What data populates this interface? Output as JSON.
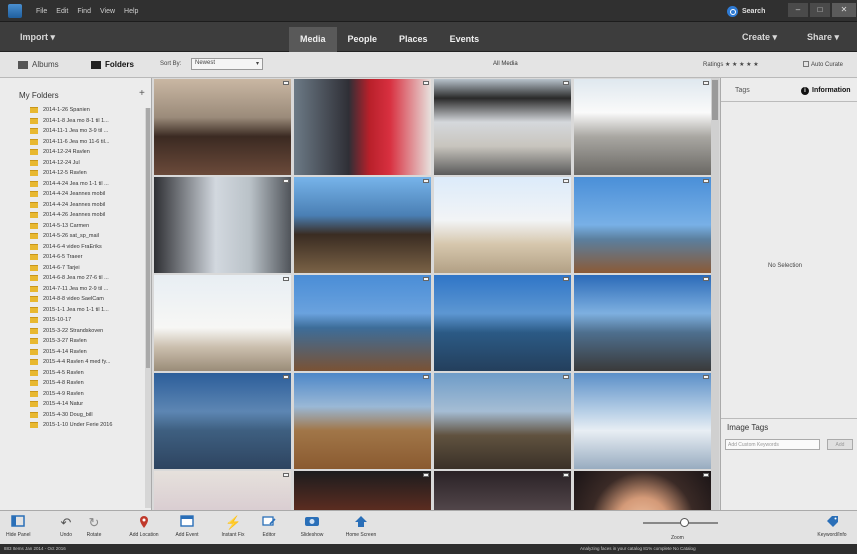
{
  "titlebar": {
    "menus": [
      "File",
      "Edit",
      "Find",
      "View",
      "Help"
    ],
    "search_label": "Search",
    "window_controls": [
      "–",
      "□",
      "✕"
    ]
  },
  "topbar": {
    "import_label": "Import ▾",
    "tabs": [
      {
        "label": "Media",
        "active": true
      },
      {
        "label": "People",
        "active": false
      },
      {
        "label": "Places",
        "active": false
      },
      {
        "label": "Events",
        "active": false
      }
    ],
    "create_label": "Create ▾",
    "share_label": "Share ▾"
  },
  "subbar": {
    "albums_label": "Albums",
    "folders_label": "Folders",
    "sort_by_label": "Sort By:",
    "sort_value": "Newest",
    "view_title": "All Media",
    "ratings_label": "Ratings ★ ★ ★ ★ ★",
    "auto_curate_label": "Auto Curate"
  },
  "left_panel": {
    "header": "My Folders",
    "folders": [
      "2014-1-26 Spanien",
      "2014-1-8 Jea mo 8-1 til 1...",
      "2014-11-1 Jea mo 3-9 til ...",
      "2014-11-6 Jea mo 11-6 til...",
      "2014-12-24 Ravlen",
      "2014-12-24 Jul",
      "2014-12-5 Ravlen",
      "2014-4-24 Jea mo 1-1 til ...",
      "2014-4-24 Jeannes mobil",
      "2014-4-24 Jeannes mobil",
      "2014-4-26 Jeannes mobil",
      "2014-5-13 Carmen",
      "2014-5-26 sat_sp_mail",
      "2014-6-4 video FraEriks",
      "2014-6-5 Traeer",
      "2014-6-7 Tarjei",
      "2014-6-8 Jea mo 27-6 til ...",
      "2014-7-11 Jea mo 2-9 til ...",
      "2014-8-8 video SaelCam",
      "2015-1-1 Jea mo 1-1 til 1...",
      "2015-10-17",
      "2015-3-22 Strandskoven",
      "2015-3-27 Ravlen",
      "2015-4-14 Ravlen",
      "2015-4-4 Ravlen 4 med fy...",
      "2015-4-5 Ravlen",
      "2015-4-8 Ravlen",
      "2015-4-9 Ravlen",
      "2015-4-14 Natur",
      "2015-4-30 Doug_bill",
      "2015-1-10 Under Ferie 2016"
    ]
  },
  "grid": {
    "thumbs": [
      "girl-portrait-platform",
      "people-red-sign-station",
      "station-platform-canopy",
      "platform-walkway-sun",
      "person-walking-platform",
      "girl-smiling-platform",
      "winter-shore-trees",
      "tree-shoreline-sea",
      "tree-silhouette-beach",
      "bare-tree-sea-view",
      "calm-sea-horizon",
      "coast-path-sunset",
      "sea-horizon-blue",
      "dry-grass-sea",
      "marsh-water-dusk",
      "frozen-shore-ice",
      "childs-drawing",
      "christmas-tree-party",
      "indoor-dim-scene",
      "woman-face-closeup"
    ]
  },
  "right_panel": {
    "tags_tab": "Tags",
    "info_tab": "Information",
    "no_selection": "No Selection",
    "image_tags_label": "Image Tags",
    "tag_placeholder": "Add Custom Keywords",
    "add_label": "Add"
  },
  "bottombar": {
    "buttons": [
      {
        "label": "Hide Panel",
        "icon": "hide-panel-icon"
      },
      {
        "label": "Undo",
        "icon": "undo-icon"
      },
      {
        "label": "Rotate",
        "icon": "rotate-icon"
      },
      {
        "label": "Add Location",
        "icon": "location-pin-icon"
      },
      {
        "label": "Add Event",
        "icon": "calendar-icon"
      },
      {
        "label": "Instant Fix",
        "icon": "instant-fix-icon"
      },
      {
        "label": "Editor",
        "icon": "editor-icon"
      },
      {
        "label": "Slideshow",
        "icon": "slideshow-icon"
      },
      {
        "label": "Home Screen",
        "icon": "home-screen-icon"
      },
      {
        "label": "Keyword/Info",
        "icon": "keyword-info-icon"
      }
    ],
    "zoom_label": "Zoom",
    "zoom_level": 0.55
  },
  "statusbar": {
    "left": "883 Items   Jan 2014 - Oct 2016",
    "right": "Analyzing faces in your catalog 81% complete     No Catalog"
  },
  "colors": {
    "chrome_dark": "#303030",
    "tab_active": "#595959",
    "accent_blue": "#2f7bd4",
    "folder_yellow": "#e8b830"
  }
}
